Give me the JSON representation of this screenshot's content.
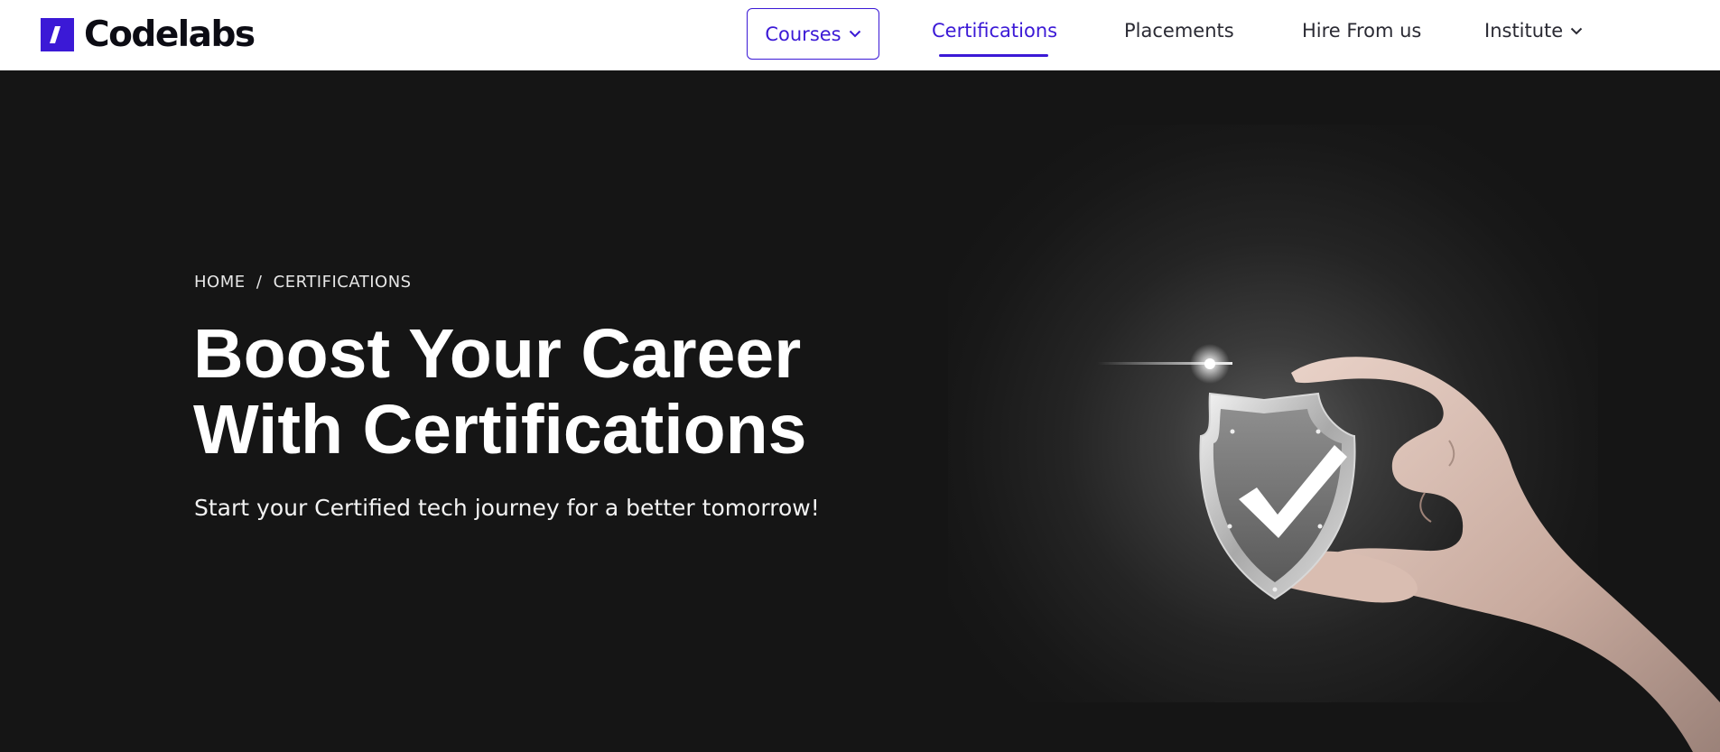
{
  "brand": {
    "name": "Codelabs",
    "accent": "#3b19d6"
  },
  "nav": {
    "courses": "Courses",
    "certifications": "Certifications",
    "placements": "Placements",
    "hire": "Hire From us",
    "institute": "Institute"
  },
  "hero": {
    "breadcrumb_home": "HOME",
    "breadcrumb_sep": "/",
    "breadcrumb_current": "CERTIFICATIONS",
    "headline_line1": "Boost Your Career",
    "headline_line2": "With Certifications",
    "subtext": "Start your Certified tech journey for a better tomorrow!"
  },
  "icons": {
    "logo": "slash-logo-icon",
    "courses_chevron": "chevron-down-icon",
    "institute_chevron": "chevron-down-icon",
    "illustration": "hand-holding-shield-check-icon"
  }
}
